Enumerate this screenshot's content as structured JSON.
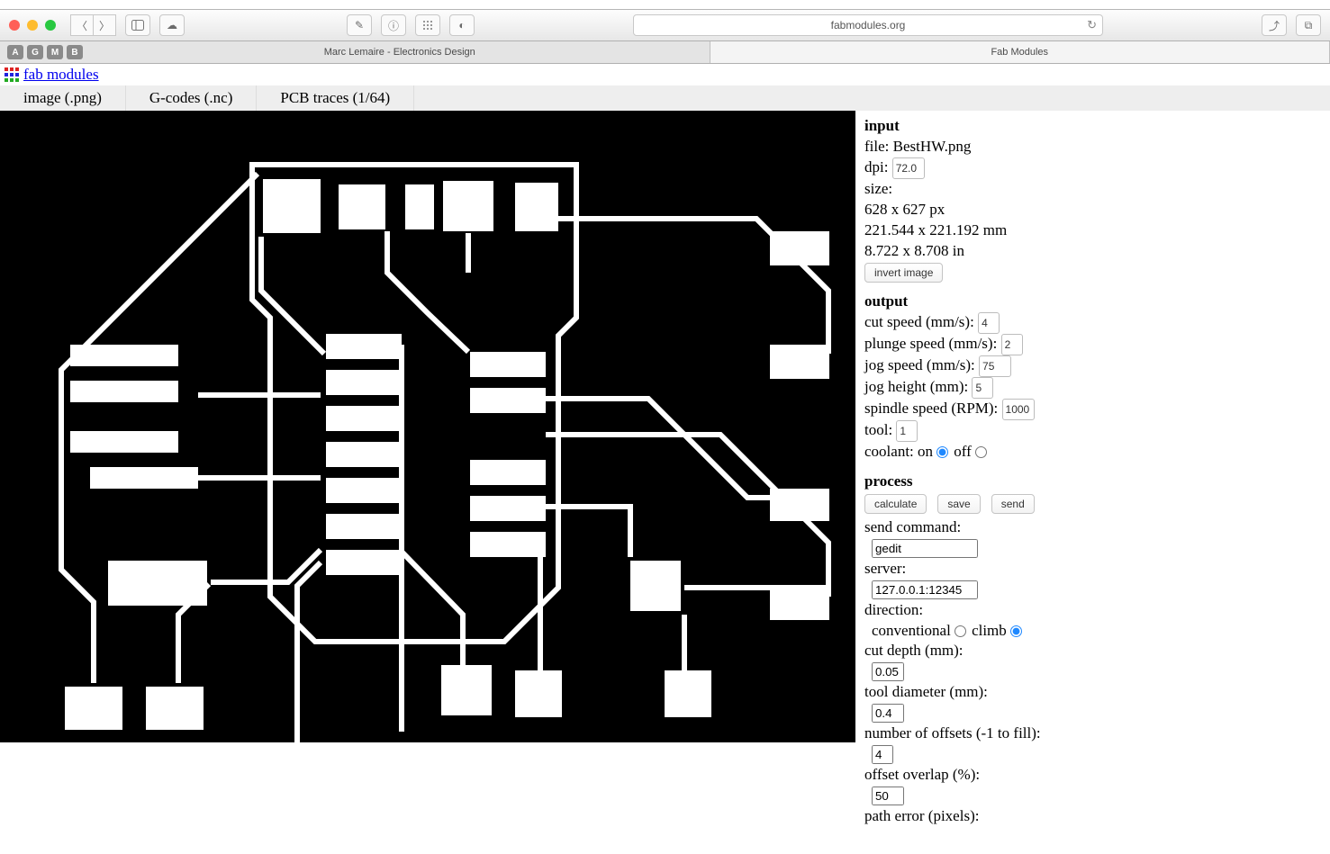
{
  "browser": {
    "url": "fabmodules.org",
    "tab_left": "Marc Lemaire - Electronics Design",
    "tab_right": "Fab Modules",
    "letters": [
      "A",
      "G",
      "M",
      "B"
    ]
  },
  "brand": "fab modules",
  "modes": {
    "input": "image (.png)",
    "output": "G-codes (.nc)",
    "process": "PCB traces (1/64)"
  },
  "input": {
    "title": "input",
    "file_label": "file:",
    "file": "BestHW.png",
    "dpi_label": "dpi:",
    "dpi": "72.0",
    "size_label": "size:",
    "size_px": "628 x 627 px",
    "size_mm": "221.544 x 221.192 mm",
    "size_in": "8.722 x 8.708 in",
    "invert": "invert image"
  },
  "output": {
    "title": "output",
    "cut_speed_label": "cut speed (mm/s):",
    "cut_speed": "4",
    "plunge_speed_label": "plunge speed (mm/s):",
    "plunge_speed": "2",
    "jog_speed_label": "jog speed (mm/s):",
    "jog_speed": "75",
    "jog_height_label": "jog height (mm):",
    "jog_height": "5",
    "spindle_label": "spindle speed (RPM):",
    "spindle": "1000",
    "tool_label": "tool:",
    "tool": "1",
    "coolant_label": "coolant:",
    "coolant_on": "on",
    "coolant_off": "off"
  },
  "process": {
    "title": "process",
    "calculate": "calculate",
    "save": "save",
    "send": "send",
    "send_cmd_label": "send command:",
    "send_cmd": "gedit",
    "server_label": "server:",
    "server": "127.0.0.1:12345",
    "direction_label": "direction:",
    "direction_conv": "conventional",
    "direction_climb": "climb",
    "cut_depth_label": "cut depth (mm):",
    "cut_depth": "0.05",
    "tool_dia_label": "tool diameter (mm):",
    "tool_dia": "0.4",
    "offsets_label": "number of offsets (-1 to fill):",
    "offsets": "4",
    "overlap_label": "offset overlap (%):",
    "overlap": "50",
    "path_err_label": "path error (pixels):"
  }
}
